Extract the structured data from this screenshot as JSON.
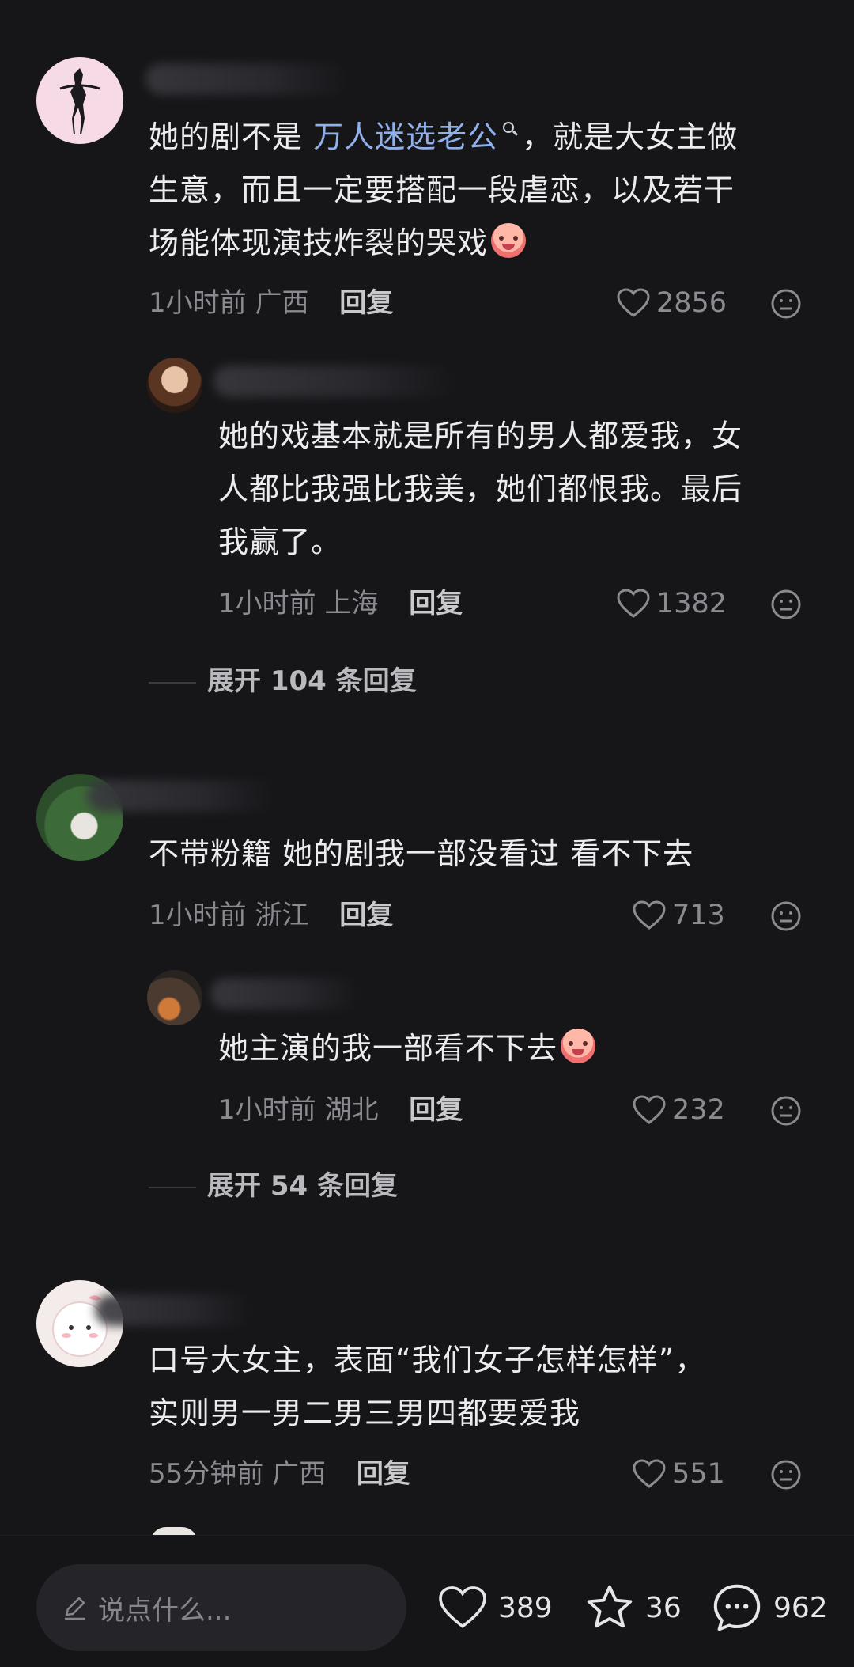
{
  "comments": [
    {
      "text_before": "她的剧不是 ",
      "link": "万人迷选老公",
      "text_line1_rest": "，就是大女主做",
      "text_line2": "生意，而且一定要搭配一段虐恋，以及若干",
      "text_line3": "场能体现演技炸裂的哭戏",
      "time": "1小时前",
      "location": "广西",
      "reply_label": "回复",
      "likes": "2856"
    },
    {
      "line1": "她的戏基本就是所有的男人都爱我，女",
      "line2": "人都比我强比我美，她们都恨我。最后",
      "line3": "我赢了。",
      "time": "1小时前",
      "location": "上海",
      "reply_label": "回复",
      "likes": "1382"
    },
    {
      "line1": "不带粉籍 她的剧我一部没看过 看不下去",
      "time": "1小时前",
      "location": "浙江",
      "reply_label": "回复",
      "likes": "713"
    },
    {
      "line1": "她主演的我一部看不下去",
      "time": "1小时前",
      "location": "湖北",
      "reply_label": "回复",
      "likes": "232"
    },
    {
      "line1": "口号大女主，表面“我们女子怎样怎样”，",
      "line2": "实则男一男二男三男四都要爱我",
      "time": "55分钟前",
      "location": "广西",
      "reply_label": "回复",
      "likes": "551"
    }
  ],
  "expand": [
    {
      "label": "展开 104 条回复"
    },
    {
      "label": "展开 54 条回复"
    }
  ],
  "bottom_bar": {
    "input_placeholder": "说点什么...",
    "likes": "389",
    "favorites": "36",
    "comments": "962"
  },
  "icons": {
    "like": "heart-outline-icon",
    "dislike": "neutral-face-icon",
    "favorite": "star-outline-icon",
    "comment": "speech-bubble-icon",
    "edit": "pencil-icon"
  },
  "colors": {
    "background": "#161619",
    "link": "#8fb0ea",
    "meta": "#8a8a90"
  }
}
